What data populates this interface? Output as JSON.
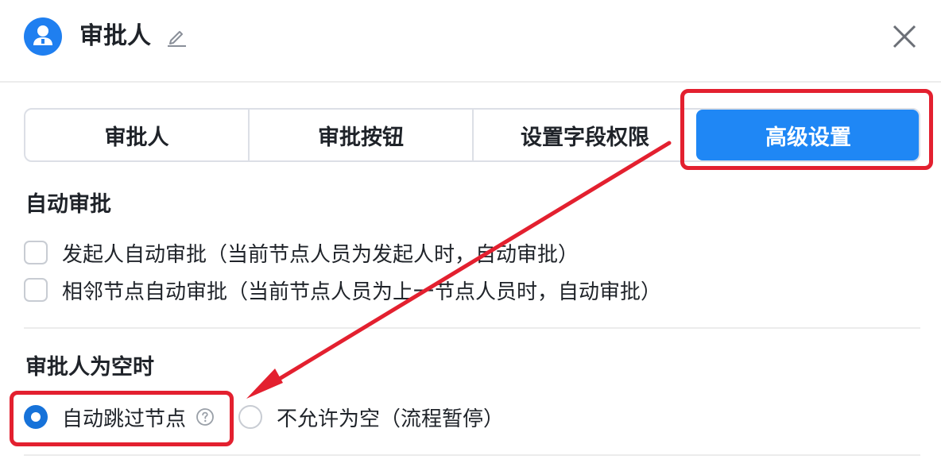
{
  "header": {
    "title": "审批人",
    "avatar_icon": "user-circle-icon",
    "edit_icon": "pencil-icon",
    "close_icon": "close-icon"
  },
  "tabs": [
    {
      "label": "审批人",
      "active": false
    },
    {
      "label": "审批按钮",
      "active": false
    },
    {
      "label": "设置字段权限",
      "active": false
    },
    {
      "label": "高级设置",
      "active": true
    }
  ],
  "auto_approve": {
    "title": "自动审批",
    "options": [
      {
        "label": "发起人自动审批（当前节点人员为发起人时，自动审批）",
        "checked": false
      },
      {
        "label": "相邻节点自动审批（当前节点人员为上一节点人员时，自动审批）",
        "checked": false
      }
    ]
  },
  "empty_approver": {
    "title": "审批人为空时",
    "options": [
      {
        "label": "自动跳过节点",
        "checked": true,
        "help_icon": "question-circle-icon"
      },
      {
        "label": "不允许为空（流程暂停）",
        "checked": false
      }
    ]
  },
  "colors": {
    "accent": "#1f87f5",
    "annotation": "#e3202f",
    "text": "#1f2329",
    "border": "#dcdfe6"
  }
}
